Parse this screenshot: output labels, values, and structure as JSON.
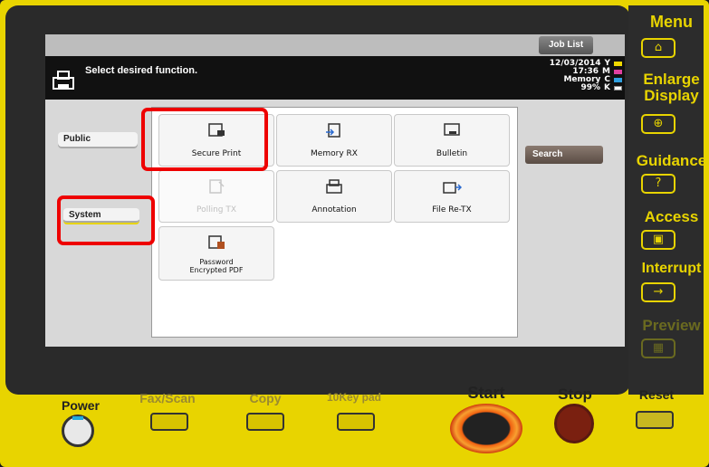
{
  "header": {
    "title": "Select desired function.",
    "job_list": "Job List"
  },
  "status": {
    "date": "12/03/2014",
    "time": "17:36",
    "memory_label": "Memory",
    "memory_value": "99%",
    "toners": [
      {
        "label": "Y",
        "color": "#f0d800"
      },
      {
        "label": "M",
        "color": "#e040a0"
      },
      {
        "label": "C",
        "color": "#30a0e0"
      },
      {
        "label": "K",
        "color": "#222"
      }
    ]
  },
  "left_tabs": [
    {
      "label": "Public"
    },
    {
      "label": "System"
    }
  ],
  "tiles": [
    {
      "label": "Secure Print",
      "enabled": true,
      "icon": "secure-print-icon"
    },
    {
      "label": "Memory RX",
      "enabled": true,
      "icon": "memory-rx-icon"
    },
    {
      "label": "Bulletin",
      "enabled": true,
      "icon": "bulletin-icon"
    },
    {
      "label": "Polling TX",
      "enabled": false,
      "icon": "polling-tx-icon"
    },
    {
      "label": "Annotation",
      "enabled": true,
      "icon": "annotation-icon"
    },
    {
      "label": "File Re-TX",
      "enabled": true,
      "icon": "file-retx-icon"
    },
    {
      "label_line1": "Password",
      "label_line2": "Encrypted PDF",
      "enabled": true,
      "icon": "encrypted-pdf-icon"
    }
  ],
  "search_label": "Search",
  "side_panel": {
    "menu": "Menu",
    "enlarge1": "Enlarge",
    "enlarge2": "Display",
    "guidance": "Guidance",
    "guidance_glyph": "?",
    "access": "Access",
    "interrupt": "Interrupt",
    "preview": "Preview"
  },
  "bottom": {
    "power": "Power",
    "fax": "Fax/Scan",
    "copy": "Copy",
    "tenkey": "10Key pad",
    "start": "Start",
    "stop": "Stop",
    "reset": "Reset"
  }
}
